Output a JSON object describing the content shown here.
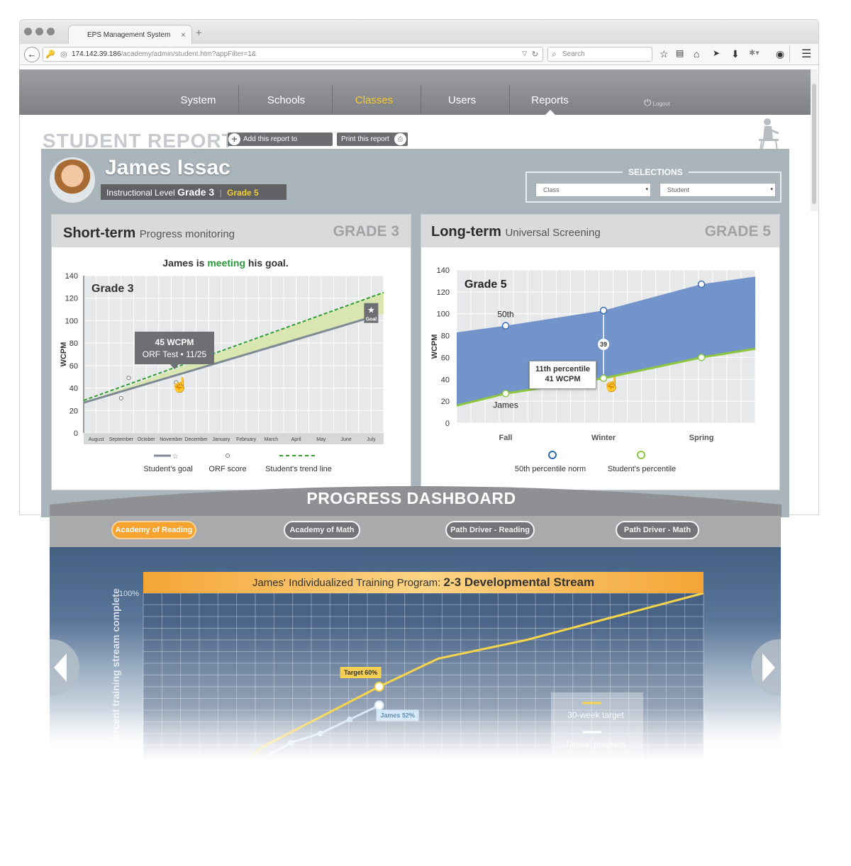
{
  "browser": {
    "tab_title": "EPS Management System",
    "tab_close": "×",
    "new_tab": "+",
    "url_host": "174.142.39.186",
    "url_path": "/academy/admin/student.htm?appFilter=1&",
    "search_placeholder": "Search"
  },
  "nav": {
    "items": [
      "System",
      "Schools",
      "Classes",
      "Users",
      "Reports"
    ],
    "active": "Classes",
    "logout": "Logout"
  },
  "report": {
    "title": "STUDENT REPORT",
    "add_btn": "Add this report to dashboard",
    "print_btn": "Print this report"
  },
  "student": {
    "name": "James Issac",
    "instr_label": "Instructional Level",
    "instr_grade": "Grade 3",
    "sep": "|",
    "current_grade": "Grade 5"
  },
  "selections": {
    "label": "SELECTIONS",
    "class": "Class",
    "student": "Student"
  },
  "short_term": {
    "title": "Short-term",
    "subtitle": "Progress monitoring",
    "grade": "GRADE 3",
    "status_pre": "James is ",
    "status_word": "meeting",
    "status_post": " his goal.",
    "tooltip_value": "45 WCPM",
    "tooltip_detail": "ORF Test • 11/25",
    "goal_badge": "Goal",
    "legend": [
      "Student's goal",
      "ORF score",
      "Student's trend line"
    ]
  },
  "long_term": {
    "title": "Long-term",
    "subtitle": "Universal Screening",
    "grade": "GRADE 5",
    "callout_pct": "11th percentile",
    "callout_val": "41 WCPM",
    "gap_value": "39",
    "label_50th": "50th",
    "label_james": "James",
    "legend": [
      "50th percentile norm",
      "Student's percentile"
    ]
  },
  "dashboard": {
    "title": "PROGRESS DASHBOARD",
    "tabs": [
      "Academy of Reading",
      "Academy of Math",
      "Path Driver - Reading",
      "Path Driver - Math"
    ],
    "active_tab": 0,
    "program_prefix": "James' Individualized Training Program:",
    "program_name": "2-3 Developmental Stream"
  },
  "chart_data": [
    {
      "type": "line",
      "title": "Grade 3",
      "ylabel": "WCPM",
      "ylim": [
        0,
        140
      ],
      "yticks": [
        0,
        20,
        40,
        60,
        80,
        100,
        120,
        140
      ],
      "categories": [
        "August",
        "September",
        "October",
        "November",
        "December",
        "January",
        "February",
        "March",
        "April",
        "May",
        "June",
        "July"
      ],
      "series": [
        {
          "name": "Student's goal",
          "x": [
            0,
            11.5
          ],
          "y": [
            27,
            103
          ]
        },
        {
          "name": "Student's trend line",
          "x": [
            0,
            12
          ],
          "y": [
            29,
            125
          ]
        },
        {
          "name": "ORF score",
          "points": [
            [
              1.5,
              31
            ],
            [
              1.8,
              49
            ],
            [
              3.7,
              45
            ]
          ]
        }
      ],
      "grid": true
    },
    {
      "type": "area",
      "title": "Grade 5",
      "ylabel": "WCPM",
      "ylim": [
        0,
        140
      ],
      "yticks": [
        0,
        20,
        40,
        60,
        80,
        100,
        120,
        140
      ],
      "categories": [
        "Fall",
        "Winter",
        "Spring"
      ],
      "series": [
        {
          "name": "50th percentile norm",
          "x": [
            -0.5,
            0,
            1,
            2,
            2.55
          ],
          "y": [
            83,
            89,
            103,
            127,
            134
          ]
        },
        {
          "name": "Student's percentile",
          "x": [
            -0.5,
            0,
            1,
            2,
            2.55
          ],
          "y": [
            16,
            27,
            41,
            60,
            68
          ]
        }
      ],
      "annotations": [
        {
          "text": "50th",
          "x": 0,
          "y": 89
        },
        {
          "text": "James",
          "x": 0,
          "y": 27
        },
        {
          "text": "39",
          "x": 1,
          "y": 72
        }
      ],
      "grid": true
    },
    {
      "type": "line",
      "title": "James' Individualized Training Program: 2-3 Developmental Stream",
      "ylabel": "Percent training stream complete",
      "yticks_visible": [
        "100%"
      ],
      "series": [
        {
          "name": "30-week target",
          "x": [
            2,
            4,
            8,
            10,
            13,
            16,
            19
          ],
          "y": [
            10,
            34,
            60,
            72,
            80,
            90,
            100
          ]
        },
        {
          "name": "James' progress",
          "x": [
            2,
            3,
            4,
            5,
            6,
            7,
            8
          ],
          "y": [
            18,
            24,
            29,
            36,
            40,
            46,
            52
          ]
        }
      ],
      "annotations": [
        {
          "text": "Target",
          "value": "60%",
          "x": 8,
          "y": 60
        },
        {
          "text": "James",
          "value": "52%",
          "x": 8,
          "y": 52
        }
      ],
      "legend": [
        "30-week target",
        "James' progress"
      ]
    }
  ],
  "colors": {
    "nav_bg": "#8b8d90",
    "nav_active": "#f6c832",
    "panel": "#aab4bb",
    "goal_line": "#7f8b94",
    "trend_line": "#2f9e2f",
    "trend_fill": "#d6e5a7",
    "norm_fill": "#6c8fc9",
    "student_line": "#8cc63f",
    "target_line": "#f7d54a",
    "progress_line": "#d4e6f5",
    "accent_orange": "#f5a22f"
  },
  "icons": [
    "back-arrow-icon",
    "key-icon",
    "globe-icon",
    "reload-icon",
    "search-icon",
    "star-icon",
    "bookmark-list-icon",
    "home-icon",
    "send-icon",
    "download-icon",
    "extension-icon",
    "chat-icon",
    "menu-icon",
    "power-icon",
    "plus-circle-icon",
    "printer-icon",
    "hand-pointer-icon"
  ]
}
